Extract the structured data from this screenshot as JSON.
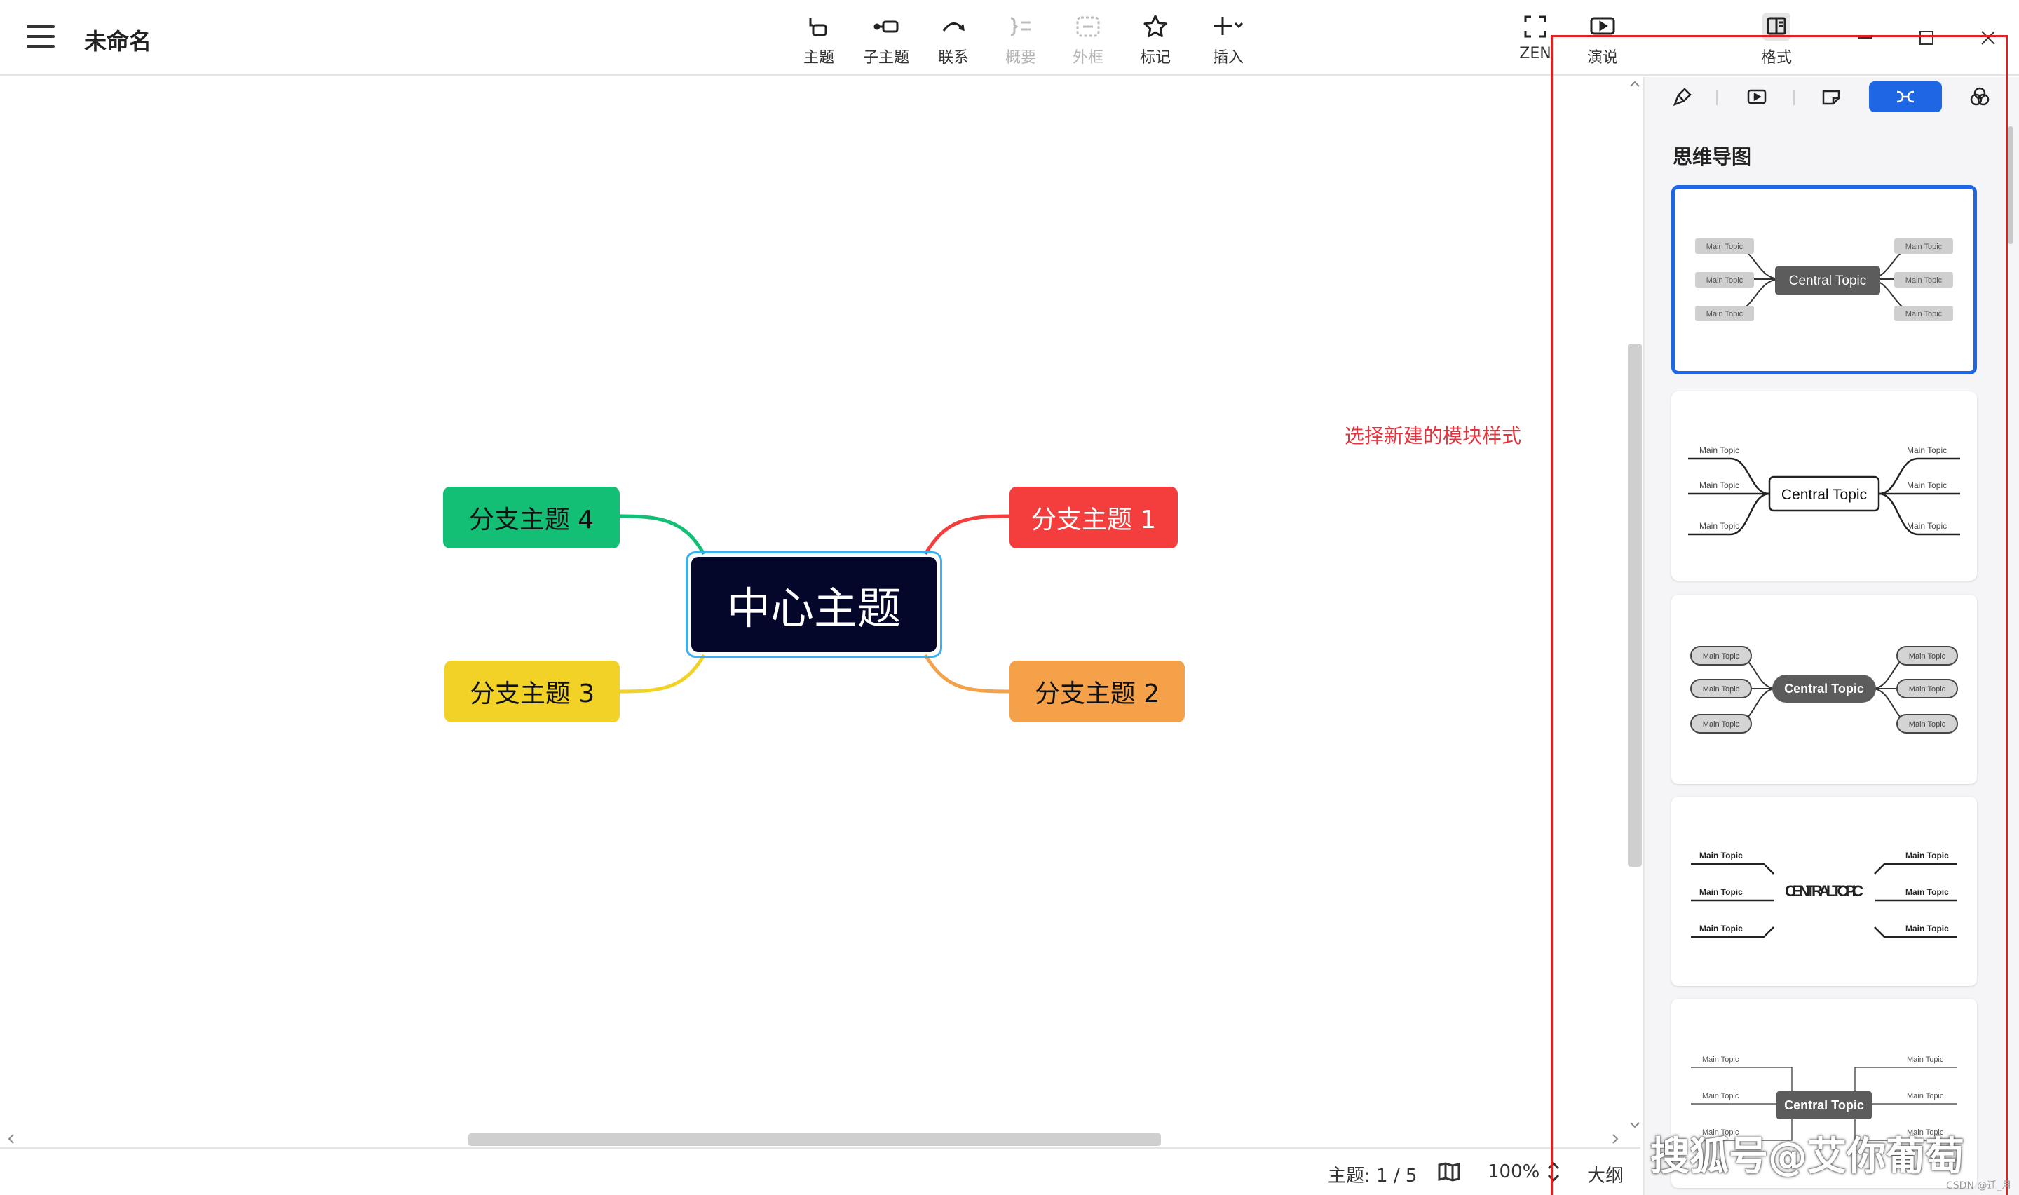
{
  "window": {
    "title": "未命名"
  },
  "toolbar": {
    "topic": "主题",
    "subtopic": "子主题",
    "relationship": "联系",
    "summary": "概要",
    "boundary": "外框",
    "marker": "标记",
    "insert": "插入",
    "zen": "ZEN",
    "present": "演说",
    "format": "格式"
  },
  "mindmap": {
    "center": "中心主题",
    "branches": [
      {
        "label": "分支主题 1",
        "color": "#f43d3d"
      },
      {
        "label": "分支主题 2",
        "color": "#f5a14a"
      },
      {
        "label": "分支主题 3",
        "color": "#f2d227"
      },
      {
        "label": "分支主题 4",
        "color": "#13be75"
      }
    ]
  },
  "annotation": "选择新建的模块样式",
  "status": {
    "topic_count": "主题: 1 / 5",
    "zoom": "100%",
    "outline": "大纲"
  },
  "panel": {
    "title": "思维导图",
    "accent": "#1f66e5",
    "styles": [
      {
        "center": "Central Topic",
        "topic": "Main Topic"
      },
      {
        "center": "Central Topic",
        "topic": "Main Topic"
      },
      {
        "center": "Central Topic",
        "topic": "Main Topic"
      },
      {
        "center": "CENTRAL TOPIC",
        "topic": "Main Topic"
      },
      {
        "center": "Central Topic",
        "topic": "Main Topic"
      }
    ]
  },
  "watermark": "搜狐号@艾你葡萄",
  "watermark_small": "CSDN @迁_月"
}
